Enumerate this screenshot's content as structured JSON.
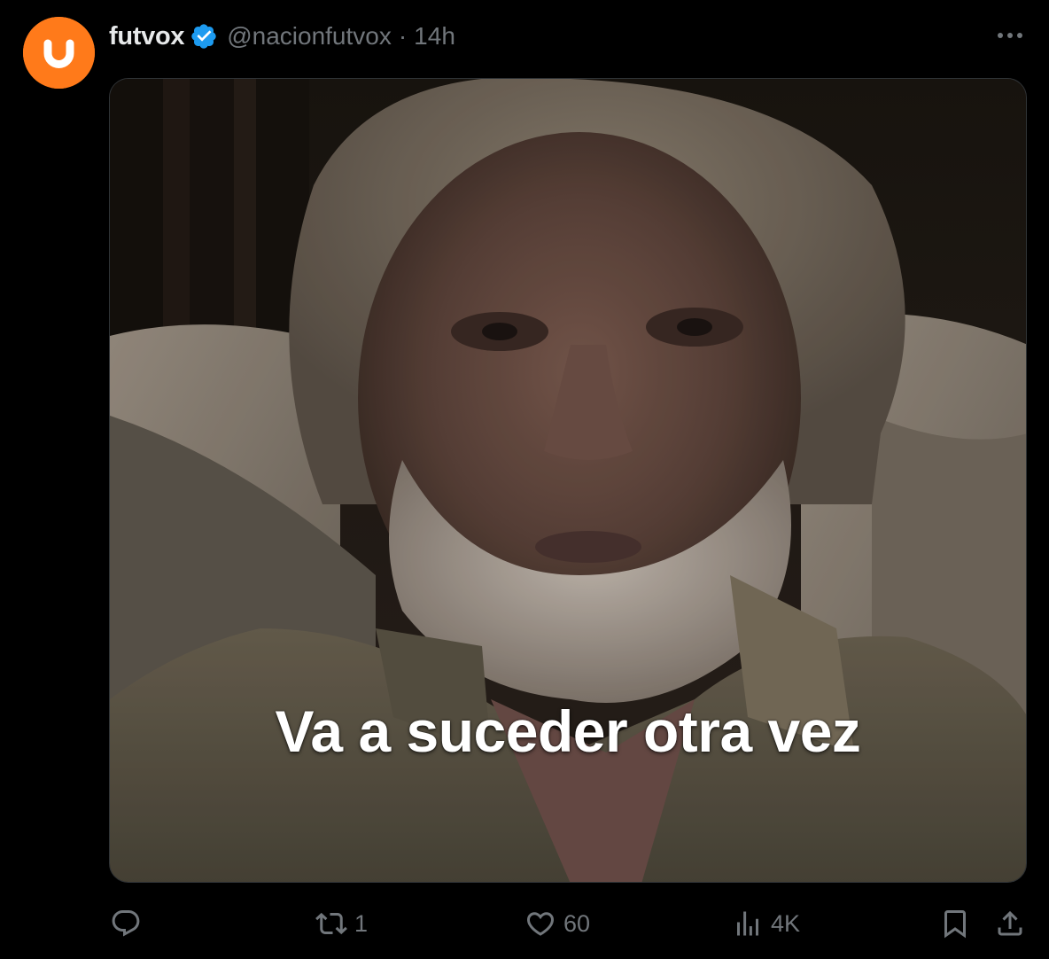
{
  "author": {
    "display_name": "futvox",
    "handle": "@nacionfutvox",
    "separator": "·",
    "time": "14h",
    "verified_icon": "verified-badge-icon",
    "avatar_color": "#ff7a1a"
  },
  "media": {
    "caption": "Va a suceder otra vez"
  },
  "actions": {
    "reply": {
      "icon": "reply-icon",
      "count": ""
    },
    "retweet": {
      "icon": "retweet-icon",
      "count": "1"
    },
    "like": {
      "icon": "heart-icon",
      "count": "60"
    },
    "views": {
      "icon": "analytics-icon",
      "count": "4K"
    },
    "bookmark": {
      "icon": "bookmark-icon"
    },
    "share": {
      "icon": "share-icon"
    }
  },
  "colors": {
    "background": "#000000",
    "text_primary": "#e7e9ea",
    "text_secondary": "#71767b",
    "verified_blue": "#1d9bf0",
    "border": "#2f3336"
  }
}
